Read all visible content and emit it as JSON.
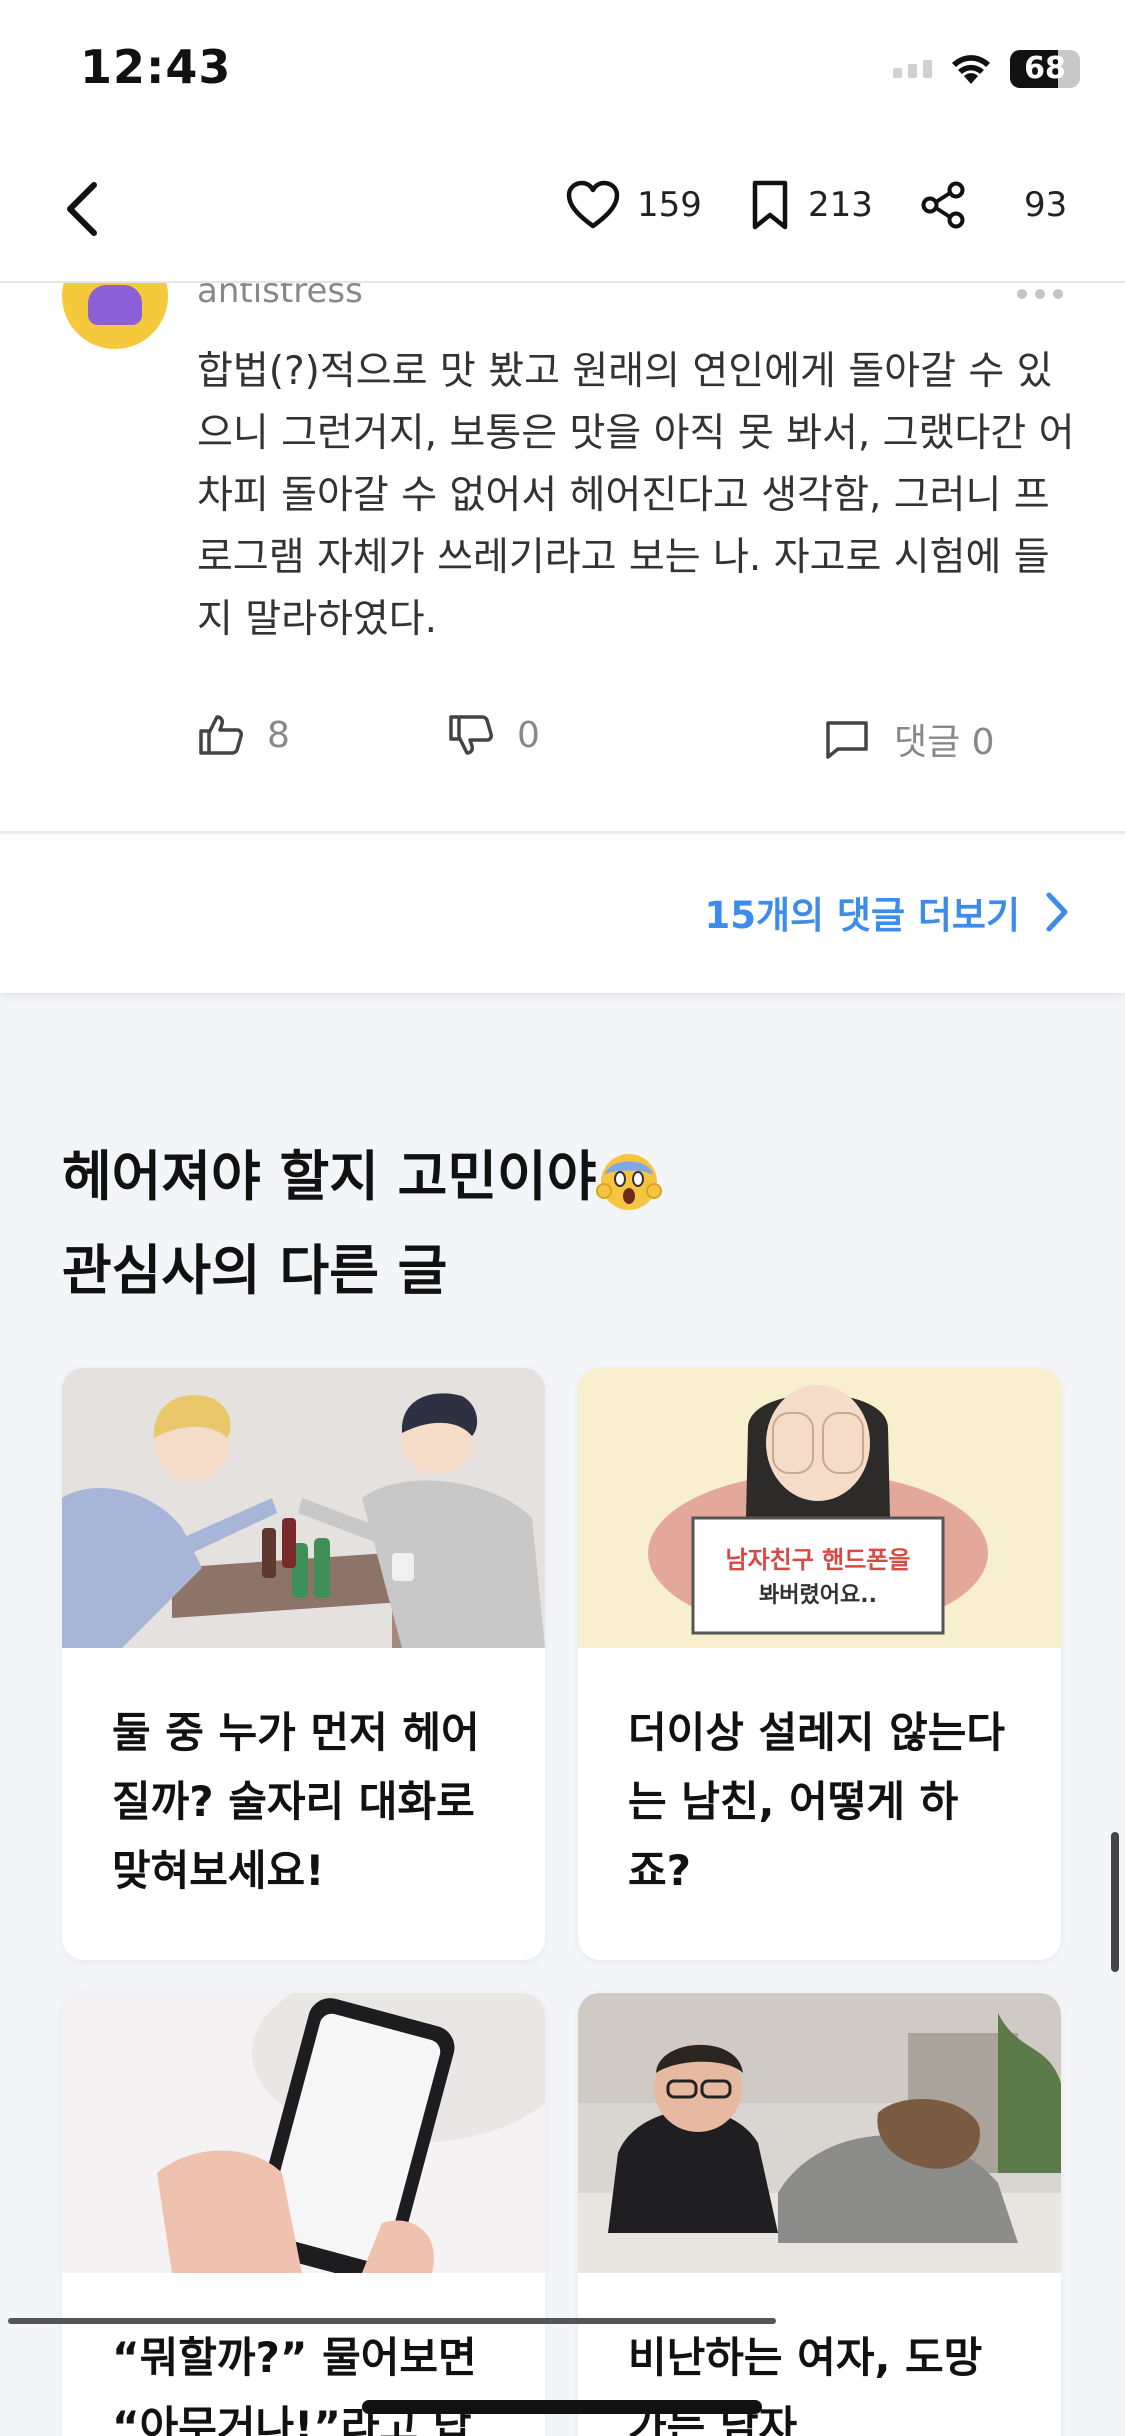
{
  "status": {
    "time": "12:43",
    "battery": "68",
    "battery_level": 0.68
  },
  "nav": {
    "likes": "159",
    "bookmarks": "213",
    "shares": "93"
  },
  "comment": {
    "username": "antistress",
    "text": "합법(?)적으로 맛 봤고 원래의 연인에게 돌아갈 수 있으니 그런거지, 보통은 맛을 아직 못 봐서, 그랬다간 어차피 돌아갈 수 없어서 헤어진다고 생각함, 그러니 프로그램 자체가 쓰레기라고 보는 나. 자고로 시험에 들지 말라하였다.",
    "likes": "8",
    "dislikes": "0",
    "replies_label": "댓글 0"
  },
  "more_comments": {
    "label": "15개의 댓글 더보기"
  },
  "section": {
    "title_line1": "헤어져야 할지 고민이야",
    "title_line2": "관심사의 다른 글"
  },
  "cards": [
    {
      "title": "둘 중 누가 먼저 헤어질까? 술자리 대화로 맞혀보세요!"
    },
    {
      "title": "더이상 설레지 않는다는 남친, 어떻게 하죠?",
      "image_text_line1": "남자친구 핸드폰을",
      "image_text_line2": "봐버렸어요.."
    },
    {
      "title": "“뭐할까?” 물어보면 “아무거나!”라고 답하"
    },
    {
      "title": "비난하는 여자, 도망가는 남자"
    }
  ],
  "colors": {
    "accent": "#3d8bea",
    "avatar": "#f6c93c"
  }
}
